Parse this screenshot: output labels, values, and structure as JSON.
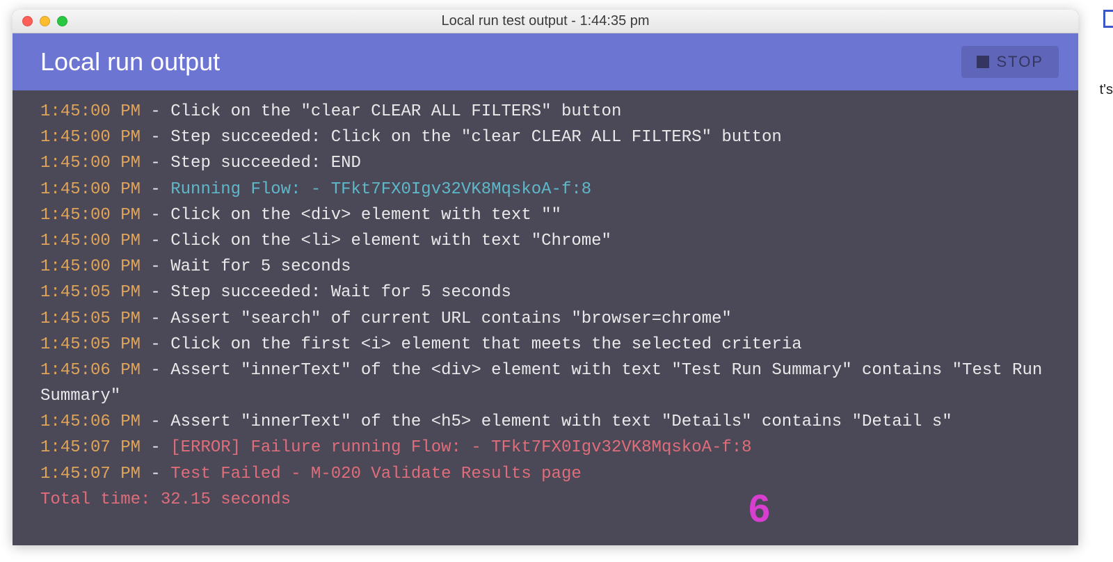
{
  "window": {
    "title": "Local run test output - 1:44:35 pm"
  },
  "header": {
    "title": "Local run output",
    "stop_label": "STOP"
  },
  "log": [
    {
      "time": "1:45:00 PM",
      "kind": "white",
      "msg": "Click on the \"clear CLEAR ALL FILTERS\" button"
    },
    {
      "time": "1:45:00 PM",
      "kind": "white",
      "msg": "Step succeeded: Click on the \"clear CLEAR ALL FILTERS\" button"
    },
    {
      "time": "1:45:00 PM",
      "kind": "white",
      "msg": "Step succeeded: END"
    },
    {
      "time": "1:45:00 PM",
      "kind": "cyan",
      "msg": "Running Flow: - TFkt7FX0Igv32VK8MqskoA-f:8"
    },
    {
      "time": "1:45:00 PM",
      "kind": "white",
      "msg": "Click on the <div> element with text \"\""
    },
    {
      "time": "1:45:00 PM",
      "kind": "white",
      "msg": "Click on the <li> element with text \"Chrome\""
    },
    {
      "time": "1:45:00 PM",
      "kind": "white",
      "msg": "Wait for 5 seconds"
    },
    {
      "time": "1:45:05 PM",
      "kind": "white",
      "msg": "Step succeeded: Wait for 5 seconds"
    },
    {
      "time": "1:45:05 PM",
      "kind": "white",
      "msg": "Assert \"search\" of current URL contains \"browser=chrome\""
    },
    {
      "time": "1:45:05 PM",
      "kind": "white",
      "msg": "Click on the first <i> element that meets the selected criteria"
    },
    {
      "time": "1:45:06 PM",
      "kind": "white",
      "msg": "Assert \"innerText\" of the <div> element with text \"Test Run Summary\" contains \"Test Run Summary\""
    },
    {
      "time": "1:45:06 PM",
      "kind": "white",
      "msg": "Assert \"innerText\" of the <h5> element with text \"Details\" contains \"Detail s\""
    },
    {
      "time": "1:45:07 PM",
      "kind": "red",
      "msg": "[ERROR] Failure running Flow: - TFkt7FX0Igv32VK8MqskoA-f:8"
    },
    {
      "time": "1:45:07 PM",
      "kind": "red",
      "msg": "Test Failed - M-020 Validate Results page"
    }
  ],
  "footer": "Total time: 32.15 seconds",
  "annotation": "6",
  "edge_text": "t's"
}
